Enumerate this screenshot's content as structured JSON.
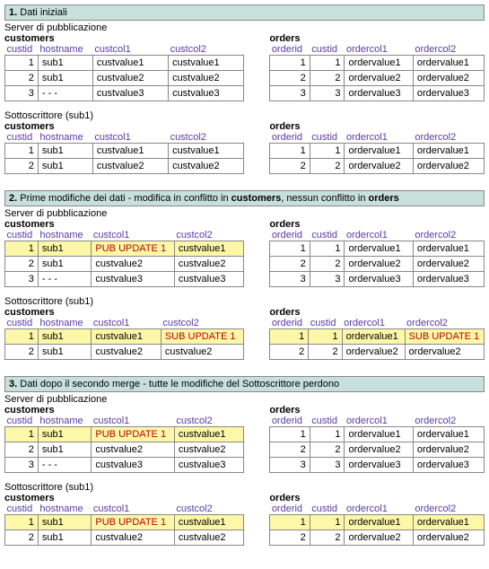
{
  "sections": [
    {
      "num": "1.",
      "title": "Dati iniziali",
      "groups": [
        {
          "label": "Server di pubblicazione",
          "customers": {
            "title": "customers",
            "cols": [
              "custid",
              "hostname",
              "custcol1",
              "custcol2"
            ],
            "rows": [
              {
                "hl": false,
                "c": [
                  "1",
                  "sub1",
                  "custvalue1",
                  "custvalue1"
                ]
              },
              {
                "hl": false,
                "c": [
                  "2",
                  "sub1",
                  "custvalue2",
                  "custvalue2"
                ]
              },
              {
                "hl": false,
                "c": [
                  "3",
                  "- - -",
                  "custvalue3",
                  "custvalue3"
                ]
              }
            ]
          },
          "orders": {
            "title": "orders",
            "cols": [
              "orderid",
              "custid",
              "ordercol1",
              "ordercol2"
            ],
            "rows": [
              {
                "hl": false,
                "c": [
                  "1",
                  "1",
                  "ordervalue1",
                  "ordervalue1"
                ]
              },
              {
                "hl": false,
                "c": [
                  "2",
                  "2",
                  "ordervalue2",
                  "ordervalue2"
                ]
              },
              {
                "hl": false,
                "c": [
                  "3",
                  "3",
                  "ordervalue3",
                  "ordervalue3"
                ]
              }
            ]
          }
        },
        {
          "label": "Sottoscrittore (sub1)",
          "customers": {
            "title": "customers",
            "cols": [
              "custid",
              "hostname",
              "custcol1",
              "custcol2"
            ],
            "rows": [
              {
                "hl": false,
                "c": [
                  "1",
                  "sub1",
                  "custvalue1",
                  "custvalue1"
                ]
              },
              {
                "hl": false,
                "c": [
                  "2",
                  "sub1",
                  "custvalue2",
                  "custvalue2"
                ]
              }
            ]
          },
          "orders": {
            "title": "orders",
            "cols": [
              "orderid",
              "custid",
              "ordercol1",
              "ordercol2"
            ],
            "rows": [
              {
                "hl": false,
                "c": [
                  "1",
                  "1",
                  "ordervalue1",
                  "ordervalue1"
                ]
              },
              {
                "hl": false,
                "c": [
                  "2",
                  "2",
                  "ordervalue2",
                  "ordervalue2"
                ]
              }
            ]
          }
        }
      ]
    },
    {
      "num": "2.",
      "title": "Prime modifiche dei dati - modifica in conflitto in <b>customers</b>, nessun conflitto in <b>orders</b>",
      "groups": [
        {
          "label": "Server di pubblicazione",
          "customers": {
            "title": "customers",
            "cols": [
              "custid",
              "hostname",
              "custcol1",
              "custcol2"
            ],
            "rows": [
              {
                "hl": true,
                "c": [
                  "1",
                  "sub1",
                  "PUB UPDATE 1",
                  "custvalue1"
                ],
                "red": [
                  2
                ]
              },
              {
                "hl": false,
                "c": [
                  "2",
                  "sub1",
                  "custvalue2",
                  "custvalue2"
                ]
              },
              {
                "hl": false,
                "c": [
                  "3",
                  "- - -",
                  "custvalue3",
                  "custvalue3"
                ]
              }
            ]
          },
          "orders": {
            "title": "orders",
            "cols": [
              "orderid",
              "custid",
              "ordercol1",
              "ordercol2"
            ],
            "rows": [
              {
                "hl": false,
                "c": [
                  "1",
                  "1",
                  "ordervalue1",
                  "ordervalue1"
                ]
              },
              {
                "hl": false,
                "c": [
                  "2",
                  "2",
                  "ordervalue2",
                  "ordervalue2"
                ]
              },
              {
                "hl": false,
                "c": [
                  "3",
                  "3",
                  "ordervalue3",
                  "ordervalue3"
                ]
              }
            ]
          }
        },
        {
          "label": "Sottoscrittore (sub1)",
          "customers": {
            "title": "customers",
            "cols": [
              "custid",
              "hostname",
              "custcol1",
              "custcol2"
            ],
            "rows": [
              {
                "hl": true,
                "c": [
                  "1",
                  "sub1",
                  "custvalue1",
                  "SUB UPDATE 1"
                ],
                "red": [
                  3
                ]
              },
              {
                "hl": false,
                "c": [
                  "2",
                  "sub1",
                  "custvalue2",
                  "custvalue2"
                ]
              }
            ]
          },
          "orders": {
            "title": "orders",
            "cols": [
              "orderid",
              "custid",
              "ordercol1",
              "ordercol2"
            ],
            "rows": [
              {
                "hl": true,
                "c": [
                  "1",
                  "1",
                  "ordervalue1",
                  "SUB UPDATE 1"
                ],
                "red": [
                  3
                ]
              },
              {
                "hl": false,
                "c": [
                  "2",
                  "2",
                  "ordervalue2",
                  "ordervalue2"
                ]
              }
            ]
          }
        }
      ]
    },
    {
      "num": "3.",
      "title": "Dati dopo il secondo merge - tutte le modifiche del Sottoscrittore perdono",
      "groups": [
        {
          "label": "Server di pubblicazione",
          "customers": {
            "title": "customers",
            "cols": [
              "custid",
              "hostname",
              "custcol1",
              "custcol2"
            ],
            "rows": [
              {
                "hl": true,
                "c": [
                  "1",
                  "sub1",
                  "PUB UPDATE 1",
                  "custvalue1"
                ],
                "red": [
                  2
                ]
              },
              {
                "hl": false,
                "c": [
                  "2",
                  "sub1",
                  "custvalue2",
                  "custvalue2"
                ]
              },
              {
                "hl": false,
                "c": [
                  "3",
                  "- - -",
                  "custvalue3",
                  "custvalue3"
                ]
              }
            ]
          },
          "orders": {
            "title": "orders",
            "cols": [
              "orderid",
              "custid",
              "ordercol1",
              "ordercol2"
            ],
            "rows": [
              {
                "hl": false,
                "c": [
                  "1",
                  "1",
                  "ordervalue1",
                  "ordervalue1"
                ]
              },
              {
                "hl": false,
                "c": [
                  "2",
                  "2",
                  "ordervalue2",
                  "ordervalue2"
                ]
              },
              {
                "hl": false,
                "c": [
                  "3",
                  "3",
                  "ordervalue3",
                  "ordervalue3"
                ]
              }
            ]
          }
        },
        {
          "label": "Sottoscrittore (sub1)",
          "customers": {
            "title": "customers",
            "cols": [
              "custid",
              "hostname",
              "custcol1",
              "custcol2"
            ],
            "rows": [
              {
                "hl": true,
                "c": [
                  "1",
                  "sub1",
                  "PUB UPDATE 1",
                  "custvalue1"
                ],
                "red": [
                  2
                ]
              },
              {
                "hl": false,
                "c": [
                  "2",
                  "sub1",
                  "custvalue2",
                  "custvalue2"
                ]
              }
            ]
          },
          "orders": {
            "title": "orders",
            "cols": [
              "orderid",
              "custid",
              "ordercol1",
              "ordercol2"
            ],
            "rows": [
              {
                "hl": true,
                "c": [
                  "1",
                  "1",
                  "ordervalue1",
                  "ordervalue1"
                ]
              },
              {
                "hl": false,
                "c": [
                  "2",
                  "2",
                  "ordervalue2",
                  "ordervalue2"
                ]
              }
            ]
          }
        }
      ]
    }
  ]
}
